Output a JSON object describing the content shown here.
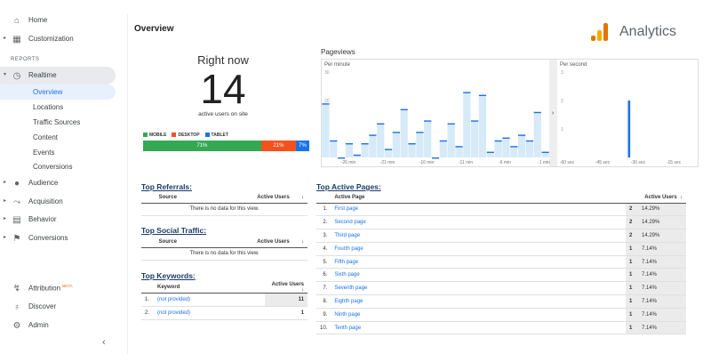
{
  "sidebar": {
    "home": "Home",
    "customization": "Customization",
    "reports_header": "REPORTS",
    "realtime": "Realtime",
    "realtime_items": [
      "Overview",
      "Locations",
      "Traffic Sources",
      "Content",
      "Events",
      "Conversions"
    ],
    "audience": "Audience",
    "acquisition": "Acquisition",
    "behavior": "Behavior",
    "conversions": "Conversions",
    "attribution": "Attribution",
    "beta": "BETA",
    "discover": "Discover",
    "admin": "Admin",
    "collapse": "‹"
  },
  "main": {
    "title": "Overview",
    "logo_text": "Analytics"
  },
  "right_now": {
    "label": "Right now",
    "count": "14",
    "caption": "active users on site"
  },
  "devices": {
    "legend": [
      "MOBILE",
      "DESKTOP",
      "TABLET"
    ],
    "colors": [
      "#34a853",
      "#f4511e",
      "#1a73e8"
    ],
    "segments": [
      {
        "label": "71%",
        "value": 71
      },
      {
        "label": "21%",
        "value": 21
      },
      {
        "label": "7%",
        "value": 7
      }
    ]
  },
  "pageviews": {
    "title": "Pageviews",
    "per_minute": "Per minute",
    "per_second": "Per second",
    "minute_ticks": [
      "-26 min",
      "-21 min",
      "-16 min",
      "-11 min",
      "-6 min",
      "-1 min"
    ],
    "second_ticks": [
      "-60 sec",
      "-45 sec",
      "-30 sec",
      "-15 sec"
    ],
    "y_ticks": [
      "30",
      "20",
      "10"
    ],
    "y_ticks_right": [
      "3",
      "2",
      "1"
    ]
  },
  "chart_data": {
    "type": "bar",
    "series": [
      {
        "name": "Per minute",
        "values": [
          19,
          6,
          0,
          5,
          1,
          5,
          8,
          12,
          3,
          9,
          17,
          5,
          9,
          13,
          0,
          6,
          12,
          4,
          23,
          13,
          22,
          2,
          6,
          7,
          4,
          8,
          6,
          16,
          2
        ]
      },
      {
        "name": "Per second",
        "values": [
          0,
          0,
          0,
          0,
          0,
          0,
          0,
          0,
          0,
          0,
          0,
          0,
          0,
          0,
          0,
          0,
          0,
          0,
          0,
          0,
          0,
          0,
          0,
          0,
          0,
          0,
          0,
          0,
          0,
          0,
          2,
          0,
          0,
          0,
          0,
          0,
          0,
          0,
          0,
          0,
          0,
          0,
          0,
          0,
          0,
          0,
          0,
          0,
          0,
          0,
          0,
          0,
          0,
          0,
          0,
          0,
          0,
          0,
          0,
          0
        ]
      }
    ],
    "ylim": [
      0,
      30
    ],
    "ylim_right": [
      0,
      3
    ]
  },
  "referrals": {
    "title": "Top Referrals:",
    "cols": [
      "Source",
      "Active Users"
    ],
    "empty": "There is no data for this view."
  },
  "social": {
    "title": "Top Social Traffic:",
    "cols": [
      "Source",
      "Active Users"
    ],
    "empty": "There is no data for this view."
  },
  "keywords": {
    "title": "Top Keywords:",
    "cols": [
      "Keyword",
      "Active Users"
    ],
    "rows": [
      {
        "n": "1.",
        "k": "(not provided)",
        "v": "11"
      },
      {
        "n": "2.",
        "k": "(not provided)",
        "v": "1"
      }
    ]
  },
  "pages": {
    "title": "Top Active Pages:",
    "cols": [
      "Active Page",
      "Active Users"
    ],
    "rows": [
      {
        "n": "1.",
        "p": "First page",
        "u": "2",
        "pct": "14.29%"
      },
      {
        "n": "2.",
        "p": "Second page",
        "u": "2",
        "pct": "14.29%"
      },
      {
        "n": "3.",
        "p": "Third page",
        "u": "2",
        "pct": "14.29%"
      },
      {
        "n": "4.",
        "p": "Fourth page",
        "u": "1",
        "pct": "7.14%"
      },
      {
        "n": "5.",
        "p": "Fifth page",
        "u": "1",
        "pct": "7.14%"
      },
      {
        "n": "6.",
        "p": "Sixth page",
        "u": "1",
        "pct": "7.14%"
      },
      {
        "n": "7.",
        "p": "Seventh page",
        "u": "1",
        "pct": "7.14%"
      },
      {
        "n": "8.",
        "p": "Eighth page",
        "u": "1",
        "pct": "7.14%"
      },
      {
        "n": "9.",
        "p": "Ninth page",
        "u": "1",
        "pct": "7.14%"
      },
      {
        "n": "10.",
        "p": "Tenth page",
        "u": "1",
        "pct": "7.14%"
      }
    ]
  },
  "sort_icon": "↓"
}
